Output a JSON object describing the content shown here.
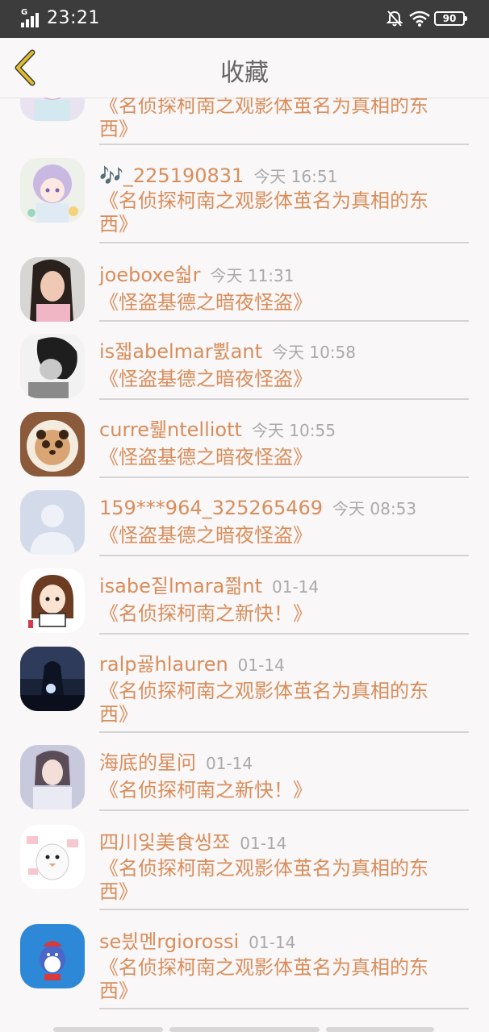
{
  "status_bar": {
    "network": "G",
    "time": "23:21",
    "battery": "90"
  },
  "header": {
    "title": "收藏",
    "back_icon": "chevron-left-icon"
  },
  "colors": {
    "accent": "#d98d5a",
    "back_icon": "#c9a623",
    "status_bar_bg": "#3c3c3c",
    "page_bg": "#f9f7f8"
  },
  "items": [
    {
      "name": "",
      "time": "",
      "content": "《名侦探柯南之观影体茧名为真相的东西》",
      "avatar": "anime-girl-avatar"
    },
    {
      "name": "🎶_225190831",
      "time": "今天 16:51",
      "content": "《名侦探柯南之观影体茧名为真相的东西》",
      "avatar": "anime-girl-avatar"
    },
    {
      "name": "joeboxe숿r",
      "time": "今天 11:31",
      "content": "《怪盗基德之暗夜怪盗》",
      "avatar": "woman-photo-avatar"
    },
    {
      "name": "is젧abelmar쀬ant",
      "time": "今天 10:58",
      "content": "《怪盗基德之暗夜怪盗》",
      "avatar": "bw-portrait-avatar"
    },
    {
      "name": "curre뤭ntelliott",
      "time": "今天 10:55",
      "content": "《怪盗基德之暗夜怪盗》",
      "avatar": "panda-latte-avatar"
    },
    {
      "name": "159***964_325265469",
      "time": "今天 08:53",
      "content": "《怪盗基德之暗夜怪盗》",
      "avatar": "default-user-avatar"
    },
    {
      "name": "isabe짙lmara쯺nt",
      "time": "01-14",
      "content": "《名侦探柯南之新快！》",
      "avatar": "cartoon-girl-avatar"
    },
    {
      "name": "ralp굟hlauren",
      "time": "01-14",
      "content": "《名侦探柯南之观影体茧名为真相的东西》",
      "avatar": "night-statue-avatar"
    },
    {
      "name": "海底的星问",
      "time": "01-14",
      "content": "《名侦探柯南之新快！》",
      "avatar": "girl-photo-avatar"
    },
    {
      "name": "四川잋美食씽쬬",
      "time": "01-14",
      "content": "《名侦探柯南之观影体茧名为真相的东西》",
      "avatar": "cartoon-bird-avatar"
    },
    {
      "name": "se븼멘rgiorossi",
      "time": "01-14",
      "content": "《名侦探柯南之观影体茧名为真相的东西》",
      "avatar": "blue-bird-avatar"
    }
  ]
}
